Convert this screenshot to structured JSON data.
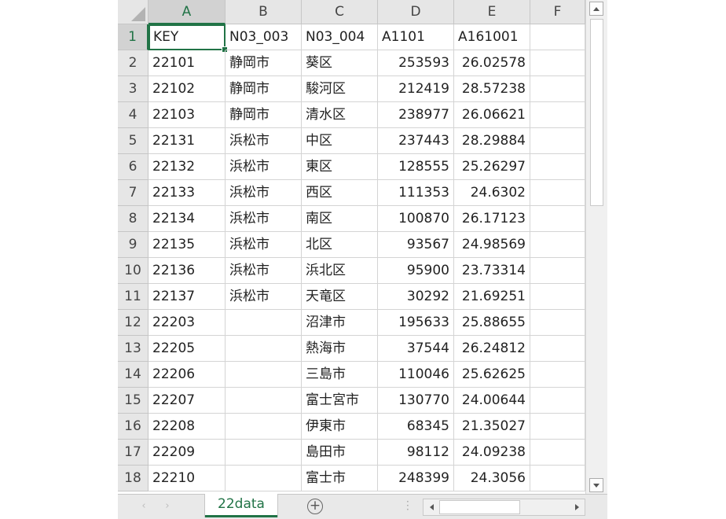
{
  "columns": [
    "A",
    "B",
    "C",
    "D",
    "E",
    "F"
  ],
  "row_numbers": [
    "1",
    "2",
    "3",
    "4",
    "5",
    "6",
    "7",
    "8",
    "9",
    "10",
    "11",
    "12",
    "13",
    "14",
    "15",
    "16",
    "17",
    "18"
  ],
  "rows": [
    [
      "KEY",
      "N03_003",
      "N03_004",
      "A1101",
      "A161001",
      ""
    ],
    [
      "22101",
      "静岡市",
      "葵区",
      "253593",
      "26.02578",
      ""
    ],
    [
      "22102",
      "静岡市",
      "駿河区",
      "212419",
      "28.57238",
      ""
    ],
    [
      "22103",
      "静岡市",
      "清水区",
      "238977",
      "26.06621",
      ""
    ],
    [
      "22131",
      "浜松市",
      "中区",
      "237443",
      "28.29884",
      ""
    ],
    [
      "22132",
      "浜松市",
      "東区",
      "128555",
      "25.26297",
      ""
    ],
    [
      "22133",
      "浜松市",
      "西区",
      "111353",
      "24.6302",
      ""
    ],
    [
      "22134",
      "浜松市",
      "南区",
      "100870",
      "26.17123",
      ""
    ],
    [
      "22135",
      "浜松市",
      "北区",
      "93567",
      "24.98569",
      ""
    ],
    [
      "22136",
      "浜松市",
      "浜北区",
      "95900",
      "23.73314",
      ""
    ],
    [
      "22137",
      "浜松市",
      "天竜区",
      "30292",
      "21.69251",
      ""
    ],
    [
      "22203",
      "",
      "沼津市",
      "195633",
      "25.88655",
      ""
    ],
    [
      "22205",
      "",
      "熱海市",
      "37544",
      "26.24812",
      ""
    ],
    [
      "22206",
      "",
      "三島市",
      "110046",
      "25.62625",
      ""
    ],
    [
      "22207",
      "",
      "富士宮市",
      "130770",
      "24.00644",
      ""
    ],
    [
      "22208",
      "",
      "伊東市",
      "68345",
      "21.35027",
      ""
    ],
    [
      "22209",
      "",
      "島田市",
      "98112",
      "24.09238",
      ""
    ],
    [
      "22210",
      "",
      "富士市",
      "248399",
      "24.3056",
      ""
    ]
  ],
  "active_cell": "A1",
  "sheet_tab": "22data",
  "accent_color": "#217346"
}
